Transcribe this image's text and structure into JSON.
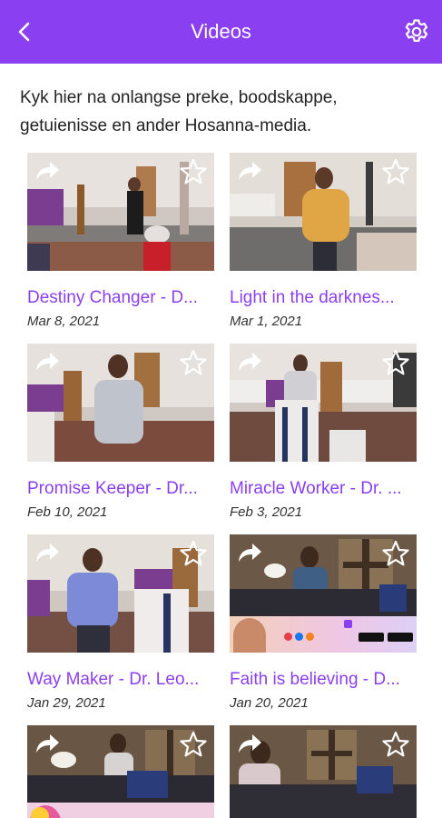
{
  "appbar": {
    "title": "Videos",
    "back_icon": "chevron-left-icon",
    "settings_icon": "gear-icon"
  },
  "intro": "Kyk hier na onlangse preke, boodskappe, getuienisse en ander Hosanna-media.",
  "colors": {
    "brand": "#8a3ff0",
    "title_text": "#8a3ff0",
    "date_text": "#333333"
  },
  "videos": [
    {
      "title": "Destiny Changer - D...",
      "date": "Mar 8, 2021"
    },
    {
      "title": "Light in the darknes...",
      "date": "Mar 1, 2021"
    },
    {
      "title": "Promise Keeper - Dr...",
      "date": "Feb 10, 2021"
    },
    {
      "title": "Miracle Worker - Dr. ...",
      "date": "Feb 3, 2021"
    },
    {
      "title": "Way Maker - Dr. Leo...",
      "date": "Jan 29, 2021"
    },
    {
      "title": "Faith is believing - D...",
      "date": "Jan 20, 2021"
    },
    {
      "title": "",
      "date": ""
    },
    {
      "title": "",
      "date": ""
    }
  ]
}
